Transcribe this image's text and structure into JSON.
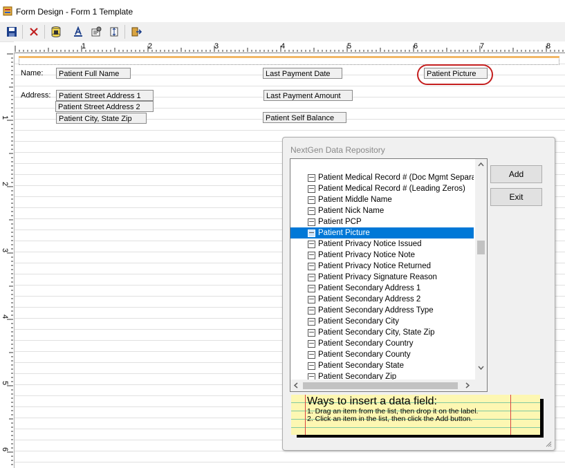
{
  "window": {
    "title": "Form Design - Form 1 Template"
  },
  "toolbar": {
    "icons": [
      "save-icon",
      "delete-icon",
      "database-icon",
      "font-icon",
      "properties-icon",
      "align-icon",
      "exit-icon"
    ]
  },
  "ruler": {
    "h_numbers": [
      "1",
      "2",
      "3",
      "4",
      "5",
      "6",
      "7",
      "8"
    ],
    "v_numbers": [
      "1",
      "2",
      "3",
      "4",
      "5",
      "6"
    ]
  },
  "form": {
    "name_label": "Name:",
    "address_label": "Address:",
    "fields": {
      "full_name": "Patient Full Name",
      "street1": "Patient Street Address 1",
      "street2": "Patient Street Address 2",
      "city_state_zip": "Patient City, State  Zip",
      "last_payment_date": "Last Payment Date",
      "last_payment_amount": "Last Payment Amount",
      "self_balance": "Patient Self Balance",
      "picture": "Patient Picture"
    }
  },
  "dialog": {
    "title": "NextGen Data Repository",
    "items": [
      "Patient Medical Record # (Doc Mgmt Separat",
      "Patient Medical Record # (Leading Zeros)",
      "Patient Middle Name",
      "Patient Nick Name",
      "Patient PCP",
      "Patient Picture",
      "Patient Privacy Notice Issued",
      "Patient Privacy Notice Note",
      "Patient Privacy Notice Returned",
      "Patient Privacy Signature Reason",
      "Patient Secondary Address 1",
      "Patient Secondary Address 2",
      "Patient Secondary Address Type",
      "Patient Secondary City",
      "Patient Secondary City, State  Zip",
      "Patient Secondary Country",
      "Patient Secondary County",
      "Patient Secondary State",
      "Patient Secondary Zip"
    ],
    "selected_item": "Patient Picture",
    "add_label": "Add",
    "exit_label": "Exit",
    "note": {
      "title": "Ways to insert a data field:",
      "line1": "1. Drag an item from the list, then drop it on the label.",
      "line2": "2. Click an item in the list, then click the Add button."
    }
  },
  "colors": {
    "selection": "#0078d7",
    "highlight_circle": "#c41e1e",
    "note_bg": "#fdf7b2"
  }
}
